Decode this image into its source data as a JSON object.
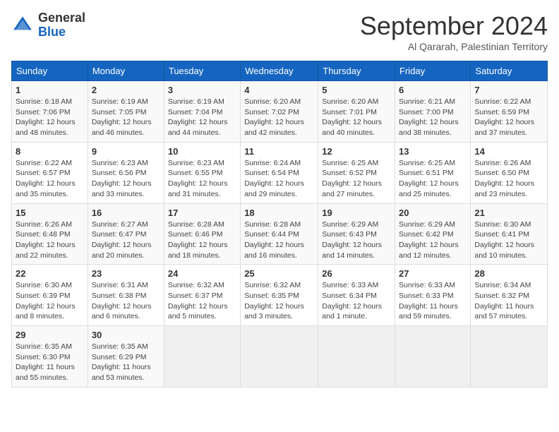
{
  "header": {
    "logo_line1": "General",
    "logo_line2": "Blue",
    "month": "September 2024",
    "location": "Al Qararah, Palestinian Territory"
  },
  "columns": [
    "Sunday",
    "Monday",
    "Tuesday",
    "Wednesday",
    "Thursday",
    "Friday",
    "Saturday"
  ],
  "weeks": [
    [
      {
        "day": "1",
        "detail": "Sunrise: 6:18 AM\nSunset: 7:06 PM\nDaylight: 12 hours\nand 48 minutes."
      },
      {
        "day": "2",
        "detail": "Sunrise: 6:19 AM\nSunset: 7:05 PM\nDaylight: 12 hours\nand 46 minutes."
      },
      {
        "day": "3",
        "detail": "Sunrise: 6:19 AM\nSunset: 7:04 PM\nDaylight: 12 hours\nand 44 minutes."
      },
      {
        "day": "4",
        "detail": "Sunrise: 6:20 AM\nSunset: 7:02 PM\nDaylight: 12 hours\nand 42 minutes."
      },
      {
        "day": "5",
        "detail": "Sunrise: 6:20 AM\nSunset: 7:01 PM\nDaylight: 12 hours\nand 40 minutes."
      },
      {
        "day": "6",
        "detail": "Sunrise: 6:21 AM\nSunset: 7:00 PM\nDaylight: 12 hours\nand 38 minutes."
      },
      {
        "day": "7",
        "detail": "Sunrise: 6:22 AM\nSunset: 6:59 PM\nDaylight: 12 hours\nand 37 minutes."
      }
    ],
    [
      {
        "day": "8",
        "detail": "Sunrise: 6:22 AM\nSunset: 6:57 PM\nDaylight: 12 hours\nand 35 minutes."
      },
      {
        "day": "9",
        "detail": "Sunrise: 6:23 AM\nSunset: 6:56 PM\nDaylight: 12 hours\nand 33 minutes."
      },
      {
        "day": "10",
        "detail": "Sunrise: 6:23 AM\nSunset: 6:55 PM\nDaylight: 12 hours\nand 31 minutes."
      },
      {
        "day": "11",
        "detail": "Sunrise: 6:24 AM\nSunset: 6:54 PM\nDaylight: 12 hours\nand 29 minutes."
      },
      {
        "day": "12",
        "detail": "Sunrise: 6:25 AM\nSunset: 6:52 PM\nDaylight: 12 hours\nand 27 minutes."
      },
      {
        "day": "13",
        "detail": "Sunrise: 6:25 AM\nSunset: 6:51 PM\nDaylight: 12 hours\nand 25 minutes."
      },
      {
        "day": "14",
        "detail": "Sunrise: 6:26 AM\nSunset: 6:50 PM\nDaylight: 12 hours\nand 23 minutes."
      }
    ],
    [
      {
        "day": "15",
        "detail": "Sunrise: 6:26 AM\nSunset: 6:48 PM\nDaylight: 12 hours\nand 22 minutes."
      },
      {
        "day": "16",
        "detail": "Sunrise: 6:27 AM\nSunset: 6:47 PM\nDaylight: 12 hours\nand 20 minutes."
      },
      {
        "day": "17",
        "detail": "Sunrise: 6:28 AM\nSunset: 6:46 PM\nDaylight: 12 hours\nand 18 minutes."
      },
      {
        "day": "18",
        "detail": "Sunrise: 6:28 AM\nSunset: 6:44 PM\nDaylight: 12 hours\nand 16 minutes."
      },
      {
        "day": "19",
        "detail": "Sunrise: 6:29 AM\nSunset: 6:43 PM\nDaylight: 12 hours\nand 14 minutes."
      },
      {
        "day": "20",
        "detail": "Sunrise: 6:29 AM\nSunset: 6:42 PM\nDaylight: 12 hours\nand 12 minutes."
      },
      {
        "day": "21",
        "detail": "Sunrise: 6:30 AM\nSunset: 6:41 PM\nDaylight: 12 hours\nand 10 minutes."
      }
    ],
    [
      {
        "day": "22",
        "detail": "Sunrise: 6:30 AM\nSunset: 6:39 PM\nDaylight: 12 hours\nand 8 minutes."
      },
      {
        "day": "23",
        "detail": "Sunrise: 6:31 AM\nSunset: 6:38 PM\nDaylight: 12 hours\nand 6 minutes."
      },
      {
        "day": "24",
        "detail": "Sunrise: 6:32 AM\nSunset: 6:37 PM\nDaylight: 12 hours\nand 5 minutes."
      },
      {
        "day": "25",
        "detail": "Sunrise: 6:32 AM\nSunset: 6:35 PM\nDaylight: 12 hours\nand 3 minutes."
      },
      {
        "day": "26",
        "detail": "Sunrise: 6:33 AM\nSunset: 6:34 PM\nDaylight: 12 hours\nand 1 minute."
      },
      {
        "day": "27",
        "detail": "Sunrise: 6:33 AM\nSunset: 6:33 PM\nDaylight: 11 hours\nand 59 minutes."
      },
      {
        "day": "28",
        "detail": "Sunrise: 6:34 AM\nSunset: 6:32 PM\nDaylight: 11 hours\nand 57 minutes."
      }
    ],
    [
      {
        "day": "29",
        "detail": "Sunrise: 6:35 AM\nSunset: 6:30 PM\nDaylight: 11 hours\nand 55 minutes."
      },
      {
        "day": "30",
        "detail": "Sunrise: 6:35 AM\nSunset: 6:29 PM\nDaylight: 11 hours\nand 53 minutes."
      },
      {
        "day": "",
        "detail": ""
      },
      {
        "day": "",
        "detail": ""
      },
      {
        "day": "",
        "detail": ""
      },
      {
        "day": "",
        "detail": ""
      },
      {
        "day": "",
        "detail": ""
      }
    ]
  ]
}
